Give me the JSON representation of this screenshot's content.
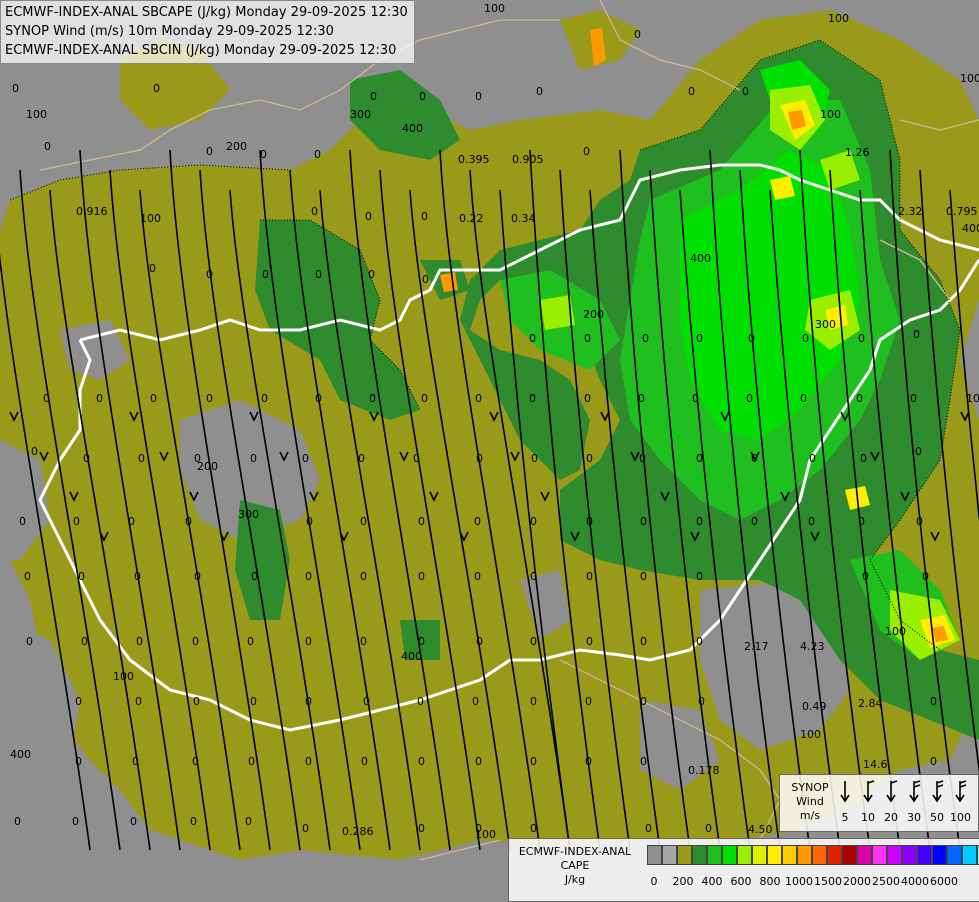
{
  "header": {
    "line1": "ECMWF-INDEX-ANAL SBCAPE (J/kg) Monday 29-09-2025 12:30",
    "line2": "SYNOP Wind (m/s) 10m Monday 29-09-2025 12:30",
    "line3": "ECMWF-INDEX-ANAL SBCIN (J/kg) Monday 29-09-2025 12:30"
  },
  "map_labels": {
    "cape_contours": [
      "100",
      "100",
      "100",
      "300",
      "400",
      "200",
      "100",
      "400",
      "200",
      "300",
      "400",
      "100",
      "200",
      "300",
      "100",
      "400",
      "100",
      "400",
      "100",
      "100",
      "100",
      "100"
    ],
    "cin_values": [
      "0.395",
      "0.905",
      "0.916",
      "0.22",
      "0.34",
      "1.26",
      "2.32",
      "0.795",
      "2.17",
      "4.23",
      "0.49",
      "2.84",
      "0.178",
      "14.6",
      "4.50",
      "0.286"
    ]
  },
  "synop_legend": {
    "title_line1": "SYNOP",
    "title_line2": "Wind",
    "title_line3": "m/s",
    "speeds": [
      "5",
      "10",
      "20",
      "30",
      "50",
      "100"
    ]
  },
  "cape_legend": {
    "title_line1": "ECMWF-INDEX-ANAL",
    "title_line2": "CAPE",
    "title_line3": "J/kg",
    "colors": [
      "#8f8f8f",
      "#a7a7a7",
      "#9a9a1a",
      "#2e8b2e",
      "#1fbf1f",
      "#00e000",
      "#9aee00",
      "#ddee00",
      "#ffee00",
      "#ffcc00",
      "#ff9900",
      "#ff6600",
      "#dd2200",
      "#aa0000",
      "#dd00aa",
      "#ff33ff",
      "#cc00ff",
      "#8800ff",
      "#4400ff",
      "#0000ff",
      "#0066ff",
      "#00ccff",
      "#66ffff",
      "#ffffff"
    ],
    "ticks": [
      "0",
      "200",
      "400",
      "600",
      "800",
      "1000",
      "1500",
      "2000",
      "2500",
      "4000",
      "6000"
    ]
  },
  "palette": {
    "bg_gray": "#8f8f8f",
    "olive": "#9a9a1a",
    "dark_green": "#2e8b2e",
    "green": "#1fbf1f",
    "bright_green": "#00e000",
    "lime": "#9aee00",
    "yellow": "#ffee00",
    "orange": "#ff9900",
    "border_white": "#ffffff",
    "border_tan": "#c8b48c"
  }
}
